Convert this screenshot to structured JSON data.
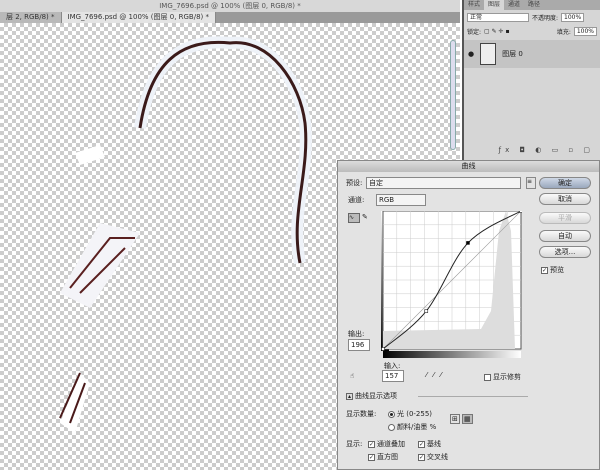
{
  "window": {
    "title": "IMG_7696.psd @ 100% (图层 0, RGB/8) *"
  },
  "doc_tabs": [
    {
      "label": "层 2, RGB/8) *"
    },
    {
      "label": "IMG_7696.psd @ 100% (图层 0, RGB/8) *"
    }
  ],
  "layers_panel": {
    "tabs": [
      "样式",
      "图层",
      "通道",
      "路径"
    ],
    "blend_mode": "正常",
    "opacity_label": "不透明度:",
    "opacity": "100%",
    "lock_label": "锁定:",
    "fill_label": "填充:",
    "fill": "100%",
    "layers": [
      {
        "name": "图层 0",
        "visible": true
      }
    ]
  },
  "curves": {
    "title": "曲线",
    "preset_label": "预设:",
    "preset": "自定",
    "channel_label": "通道:",
    "channel": "RGB",
    "buttons": {
      "ok": "确定",
      "cancel": "取消",
      "smooth": "平滑",
      "auto": "自动",
      "options": "选项..."
    },
    "preview_label": "预览",
    "preview": true,
    "output_label": "输出:",
    "output": "196",
    "input_label": "输入:",
    "input": "157",
    "show_clipping": "显示修剪",
    "display_options": "曲线显示选项",
    "show_amount_label": "显示数量:",
    "amount_light": "光 (0-255)",
    "amount_pigment": "颜料/油墨 %",
    "show_label": "显示:",
    "show": {
      "channel_overlays": "通道叠加",
      "baseline": "基线",
      "histogram": "直方图",
      "intersection": "交叉线"
    },
    "curve_points": [
      [
        0,
        0
      ],
      [
        80,
        70
      ],
      [
        157,
        196
      ],
      [
        255,
        255
      ]
    ]
  }
}
